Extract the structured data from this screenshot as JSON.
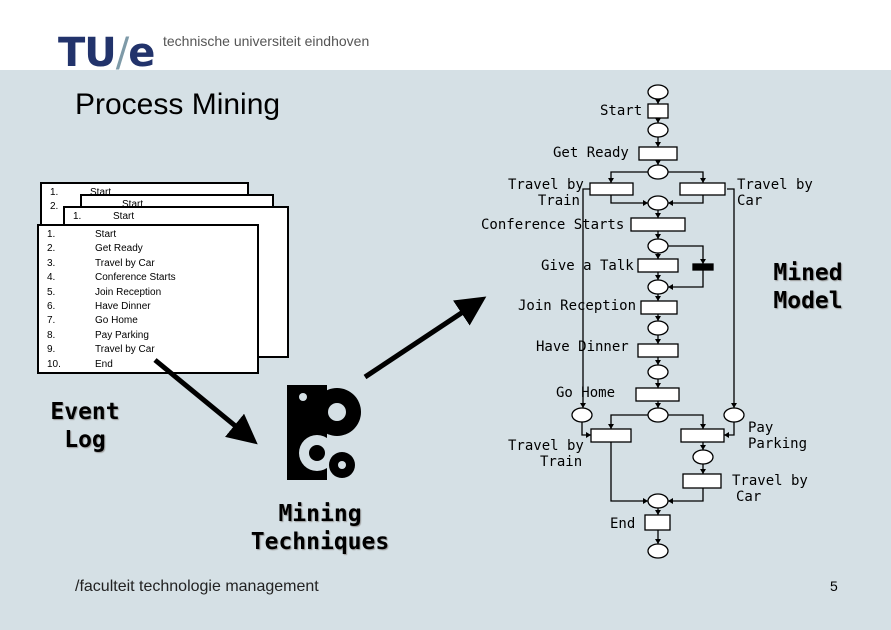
{
  "header": {
    "logo": "TU/e",
    "logo_tu": "TU",
    "logo_slash": "/",
    "logo_e": "e",
    "university": "technische universiteit eindhoven"
  },
  "title": "Process Mining",
  "event_log": {
    "label": "Event\nLog",
    "label1": "Event",
    "label2": "Log",
    "back_first": "Start",
    "entries": [
      {
        "n": "1.",
        "a": "Start"
      },
      {
        "n": "2.",
        "a": "Get Ready"
      },
      {
        "n": "3.",
        "a": "Travel by Car"
      },
      {
        "n": "4.",
        "a": "Conference Starts"
      },
      {
        "n": "5.",
        "a": "Join Reception"
      },
      {
        "n": "6.",
        "a": "Have Dinner"
      },
      {
        "n": "7.",
        "a": "Go Home"
      },
      {
        "n": "8.",
        "a": "Pay Parking"
      },
      {
        "n": "9.",
        "a": "Travel by Car"
      },
      {
        "n": "10.",
        "a": "End"
      }
    ],
    "back_nums": [
      "1.",
      "2.",
      "3."
    ]
  },
  "mining": {
    "label1": "Mining",
    "label2": "Techniques",
    "icon": "gears-icon"
  },
  "model": {
    "label1": "Mined",
    "label2": "Model",
    "labels": {
      "start": "Start",
      "get_ready": "Get Ready",
      "train1a": "Travel by",
      "train1b": "Train",
      "car1a": "Travel by",
      "car1b": "Car",
      "conf": "Conference Starts",
      "talk": "Give a Talk",
      "reception": "Join Reception",
      "dinner": "Have Dinner",
      "home": "Go Home",
      "parking1": "Pay",
      "parking2": "Parking",
      "train2a": "Travel by",
      "train2b": "Train",
      "car2a": "Travel by",
      "car2b": "Car",
      "end": "End"
    }
  },
  "footer": {
    "text": "/faculteit technologie management",
    "page": "5"
  }
}
